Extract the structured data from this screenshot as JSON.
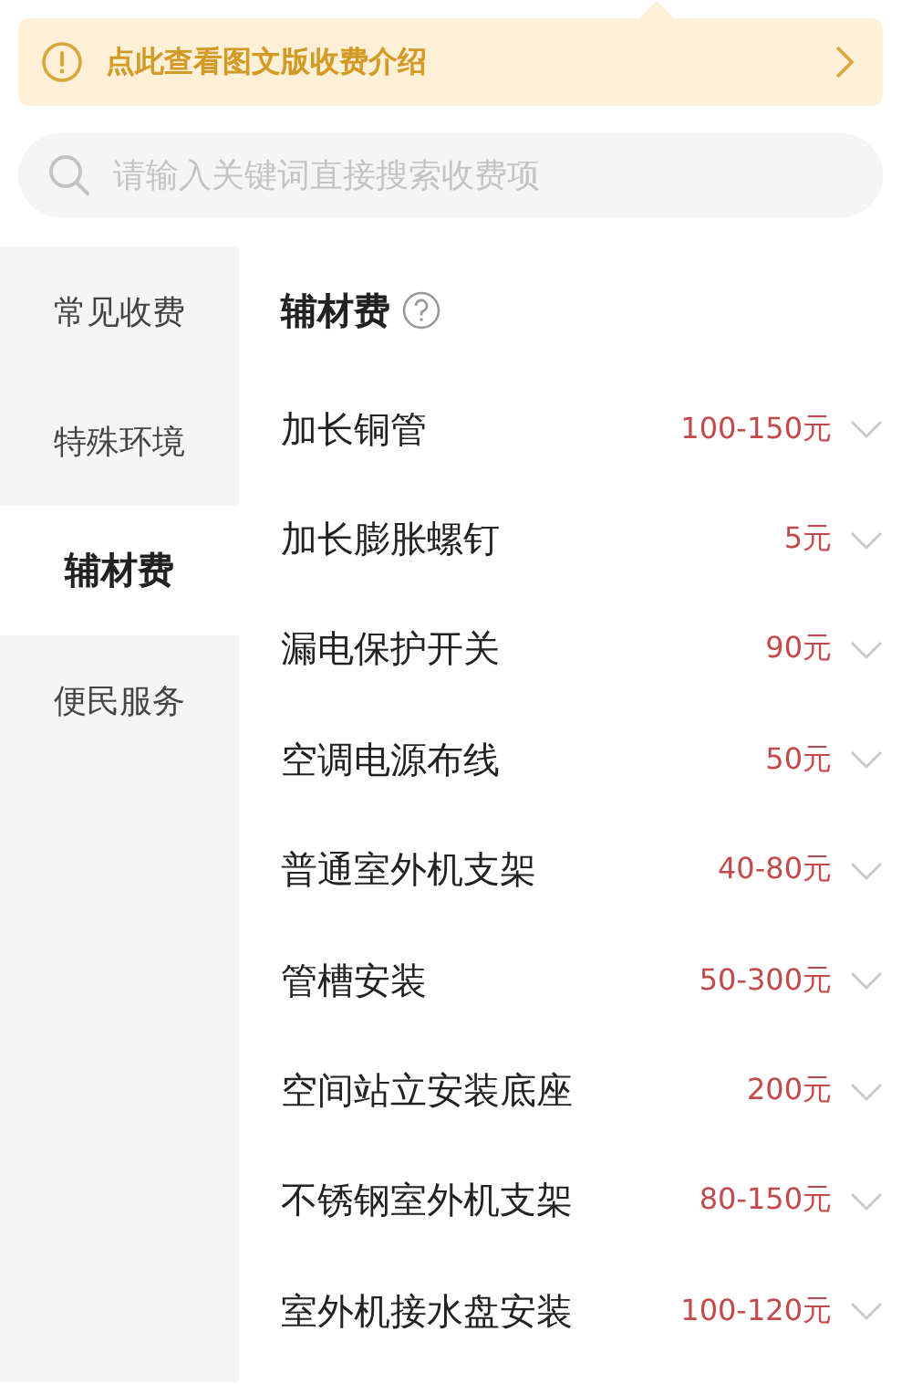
{
  "banner": {
    "text": "点此查看图文版收费介绍"
  },
  "search": {
    "placeholder": "请输入关键词直接搜索收费项"
  },
  "sidebar": {
    "items": [
      {
        "label": "常见收费",
        "selected": false
      },
      {
        "label": "特殊环境",
        "selected": false
      },
      {
        "label": "辅材费",
        "selected": true
      },
      {
        "label": "便民服务",
        "selected": false
      }
    ]
  },
  "section": {
    "title": "辅材费",
    "items": [
      {
        "name": "加长铜管",
        "price": "100-150元",
        "expanded": false
      },
      {
        "name": "加长膨胀螺钉",
        "price": "5元",
        "expanded": false
      },
      {
        "name": "漏电保护开关",
        "price": "90元",
        "expanded": false
      },
      {
        "name": "空调电源布线",
        "price": "50元",
        "expanded": false
      },
      {
        "name": "普通室外机支架",
        "price": "40-80元",
        "expanded": false
      },
      {
        "name": "管槽安装",
        "price": "50-300元",
        "expanded": false
      },
      {
        "name": "空间站立安装底座",
        "price": "200元",
        "expanded": false
      },
      {
        "name": "不锈钢室外机支架",
        "price": "80-150元",
        "expanded": false
      },
      {
        "name": "室外机接水盘安装",
        "price": "100-120元",
        "expanded": false
      }
    ]
  }
}
